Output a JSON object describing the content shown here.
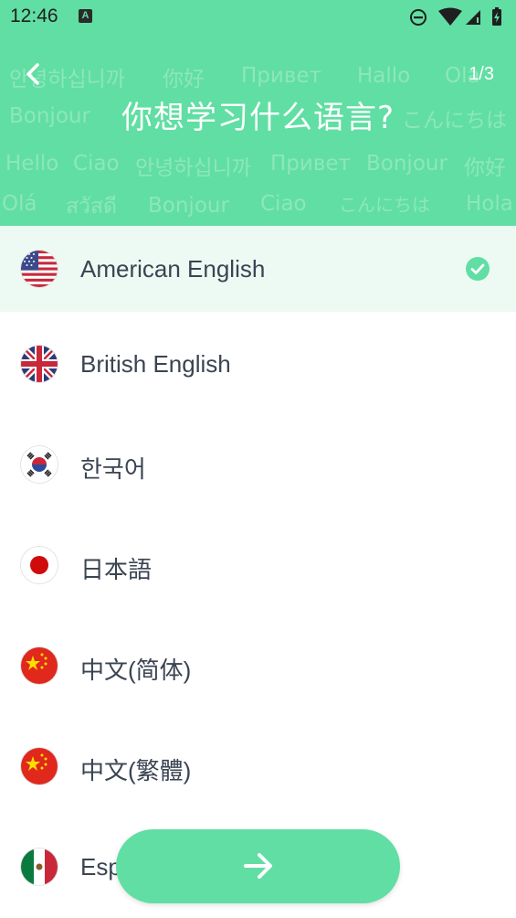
{
  "status_bar": {
    "time": "12:46",
    "notification_icon": "A"
  },
  "header": {
    "title": "你想学习什么语言?",
    "page_counter": "1/3",
    "background_words": [
      "안녕하십니까",
      "你好",
      "Привет",
      "Hallo",
      "Ola",
      "Bonjour",
      "こんにちは",
      "Hello",
      "Ciao",
      "안녕하십니까",
      "Привет",
      "Bonjour",
      "你好",
      "Olá",
      "สวัสดี",
      "Bonjour",
      "Ciao",
      "こんにちは",
      "Hola"
    ],
    "accent_color": "#61DEA3"
  },
  "languages": [
    {
      "name": "American English",
      "flag": "us-flag-icon",
      "selected": true
    },
    {
      "name": "British English",
      "flag": "uk-flag-icon",
      "selected": false
    },
    {
      "name": "한국어",
      "flag": "korea-flag-icon",
      "selected": false
    },
    {
      "name": "日本語",
      "flag": "japan-flag-icon",
      "selected": false
    },
    {
      "name": "中文(简体)",
      "flag": "china-flag-icon",
      "selected": false
    },
    {
      "name": "中文(繁體)",
      "flag": "china-flag-icon",
      "selected": false
    },
    {
      "name": "Esp",
      "flag": "mexico-flag-icon",
      "selected": false
    }
  ],
  "next_button": {
    "icon": "arrow-right-icon"
  }
}
